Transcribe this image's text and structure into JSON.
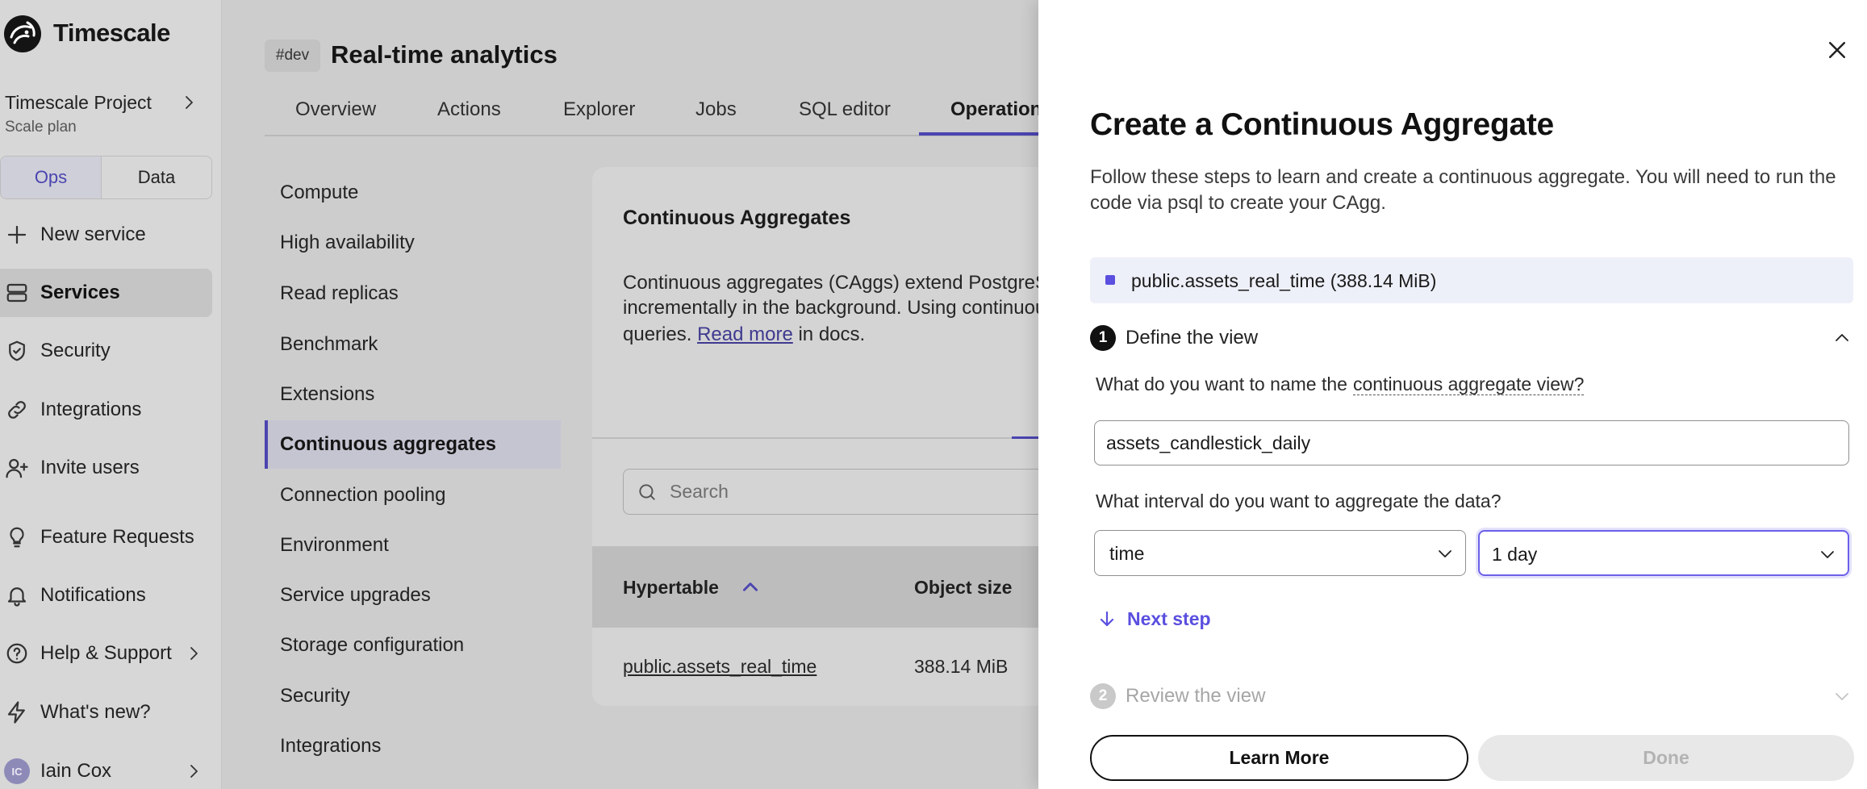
{
  "theme": {
    "accent": "#5a4fdf",
    "overlay_dimmed_accent": "#4b44b0",
    "panel_background": "#ffffff"
  },
  "sidebar": {
    "brand": "Timescale",
    "logo_icon": "timescale-logo-icon",
    "project": {
      "name": "Timescale Project",
      "plan": "Scale plan"
    },
    "mode_toggle": {
      "options": [
        "Ops",
        "Data"
      ],
      "selected": "Ops"
    },
    "nav": [
      {
        "label": "New service",
        "icon": "plus-icon"
      },
      {
        "label": "Services",
        "icon": "services-icon",
        "active": true
      },
      {
        "label": "Security",
        "icon": "shield-check-icon"
      },
      {
        "label": "Integrations",
        "icon": "link-icon"
      },
      {
        "label": "Invite users",
        "icon": "user-plus-icon"
      },
      {
        "label": "Feature Requests",
        "icon": "lightbulb-icon"
      },
      {
        "label": "Notifications",
        "icon": "bell-icon"
      },
      {
        "label": "Help & Support",
        "icon": "help-circle-icon",
        "has_submenu": true
      },
      {
        "label": "What's new?",
        "icon": "lightning-icon"
      }
    ],
    "user": {
      "initials": "IC",
      "name": "Iain Cox"
    }
  },
  "header": {
    "env_badge": "#dev",
    "title": "Real-time analytics",
    "tabs": [
      {
        "label": "Overview"
      },
      {
        "label": "Actions"
      },
      {
        "label": "Explorer"
      },
      {
        "label": "Jobs"
      },
      {
        "label": "SQL editor"
      },
      {
        "label": "Operations",
        "active": true
      }
    ]
  },
  "settings_nav": {
    "items": [
      "Compute",
      "High availability",
      "Read replicas",
      "Benchmark",
      "Extensions",
      "Continuous aggregates",
      "Connection pooling",
      "Environment",
      "Service upgrades",
      "Storage configuration",
      "Security",
      "Integrations"
    ],
    "active": "Continuous aggregates"
  },
  "caggs_card": {
    "title": "Continuous Aggregates",
    "description": {
      "line1": "Continuous aggregates (CAggs) extend PostgreS",
      "line2": "incrementally in the background. Using continuou",
      "line3_prefix": "queries. ",
      "link": "Read more",
      "line3_suffix": " in docs."
    },
    "search_placeholder": "Search",
    "table": {
      "columns": [
        "Hypertable",
        "Object size"
      ],
      "sort": {
        "column": "Hypertable",
        "direction": "ascending"
      },
      "rows": [
        {
          "hypertable": "public.assets_real_time",
          "object_size": "388.14 MiB"
        }
      ]
    }
  },
  "panel": {
    "title": "Create a Continuous Aggregate",
    "description": "Follow these steps to learn and create a continuous aggregate. You will need to run the code via psql to create your CAgg.",
    "selected_hypertable": "public.assets_real_time (388.14 MiB)",
    "steps": [
      {
        "number": "1",
        "label": "Define the view",
        "expanded": true
      },
      {
        "number": "2",
        "label": "Review the view",
        "expanded": false
      }
    ],
    "name_question": "What do you want to name the",
    "name_term": "continuous aggregate view?",
    "name_value": "assets_candlestick_daily",
    "interval_question": "What interval do you want to aggregate the data?",
    "interval_column": "time",
    "interval_value": "1 day",
    "next_step": "Next step",
    "buttons": {
      "learn_more": "Learn More",
      "done": "Done"
    }
  }
}
